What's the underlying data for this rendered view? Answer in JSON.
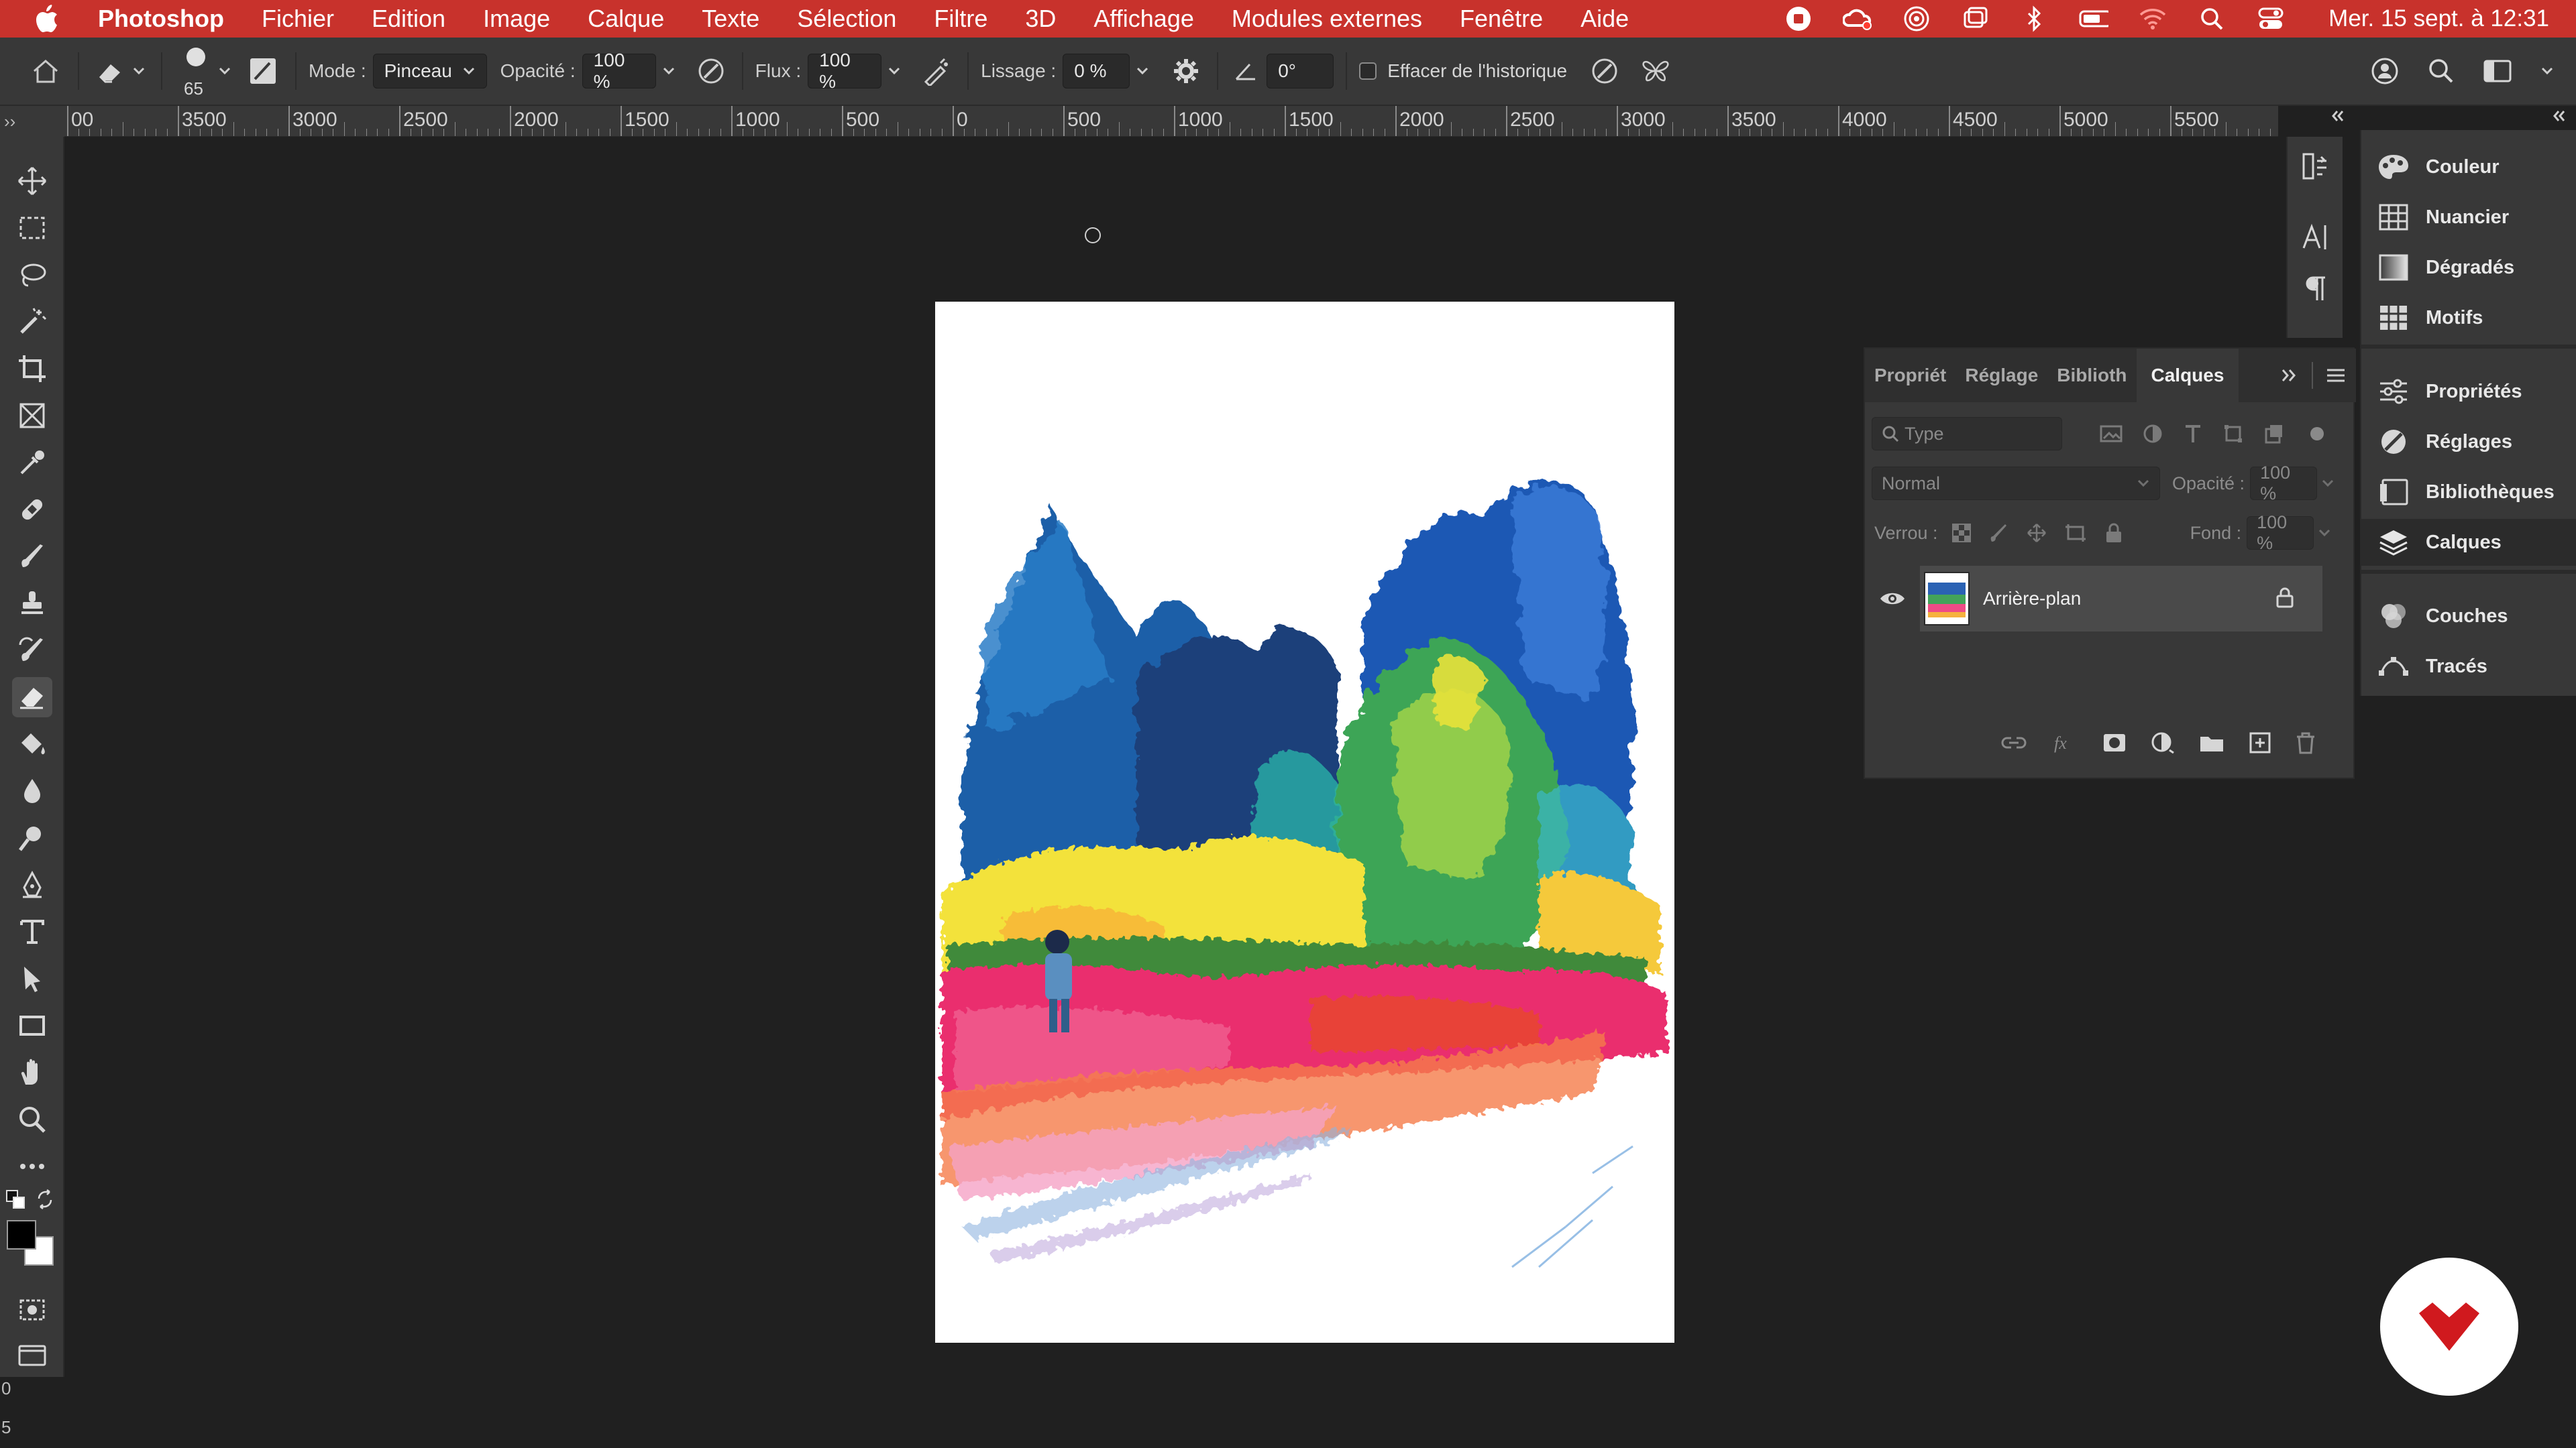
{
  "menubar": {
    "app_name": "Photoshop",
    "items": [
      "Fichier",
      "Edition",
      "Image",
      "Calque",
      "Texte",
      "Sélection",
      "Filtre",
      "3D",
      "Affichage",
      "Modules externes",
      "Fenêtre",
      "Aide"
    ],
    "clock": "Mer. 15 sept. à 12:31"
  },
  "options": {
    "brush_size": "65",
    "mode_label": "Mode :",
    "mode_value": "Pinceau",
    "opacity_label": "Opacité :",
    "opacity_value": "100 %",
    "flow_label": "Flux :",
    "flow_value": "100 %",
    "smoothing_label": "Lissage :",
    "smoothing_value": "0 %",
    "angle_value": "0°",
    "erase_history_label": "Effacer de l'historique"
  },
  "ruler": {
    "labels": [
      "00",
      "3500",
      "3000",
      "2500",
      "2000",
      "1500",
      "1000",
      "500",
      "0",
      "500",
      "1000",
      "1500",
      "2000",
      "2500",
      "3000",
      "3500",
      "4000",
      "4500",
      "5000",
      "5500"
    ],
    "corner_label": "››"
  },
  "right_list": {
    "group1": [
      "Couleur",
      "Nuancier",
      "Dégradés",
      "Motifs"
    ],
    "group2": [
      "Propriétés",
      "Réglages",
      "Bibliothèques",
      "Calques"
    ],
    "group3": [
      "Couches",
      "Tracés"
    ],
    "active": "Calques"
  },
  "layers_panel": {
    "tabs": [
      "Propriét",
      "Réglage",
      "Biblioth",
      "Calques"
    ],
    "active_tab": "Calques",
    "filter_placeholder": "Type",
    "blend_mode": "Normal",
    "opacity_label": "Opacité :",
    "opacity_value": "100 %",
    "lock_label": "Verrou :",
    "fill_label": "Fond :",
    "fill_value": "100 %",
    "layer_name": "Arrière-plan"
  },
  "colors": {
    "menubar": "#c8322c",
    "panel_bg": "#383838",
    "app_bg": "#202020",
    "badge_red": "#d0191e"
  },
  "left_bottom": {
    "label_0": "0",
    "label_5": "5"
  }
}
